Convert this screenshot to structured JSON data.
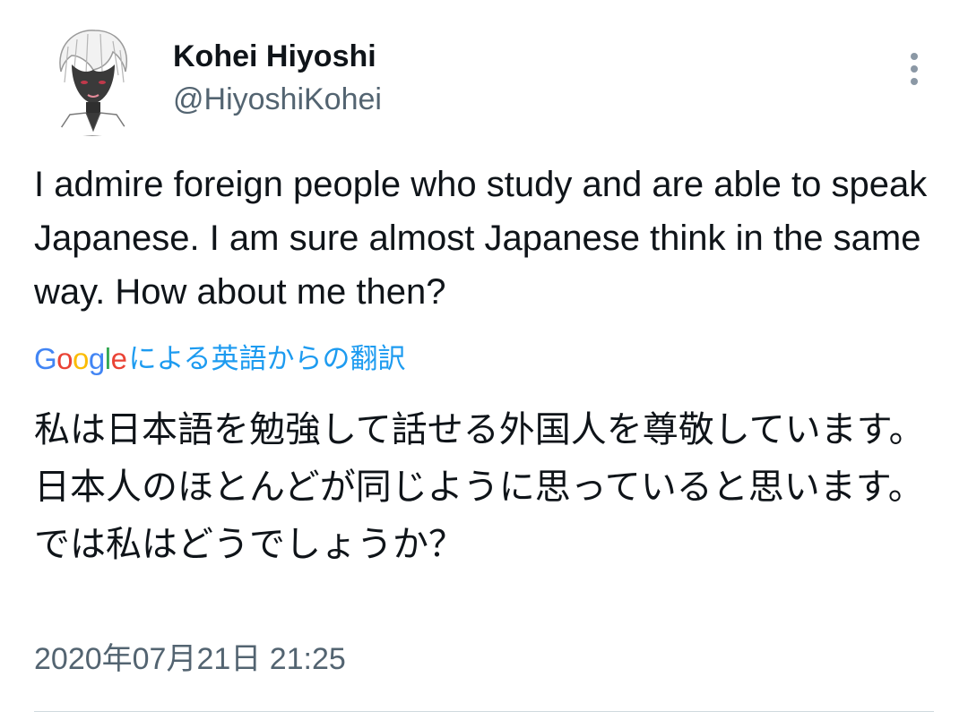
{
  "author": {
    "display_name": "Kohei Hiyoshi",
    "handle": "@HiyoshiKohei"
  },
  "tweet": {
    "text": "I admire foreign people who study and are able to speak Japanese. I am sure almost Japanese think in the same way. How about me then?",
    "translation_label": {
      "brand": "Google",
      "text": "による英語からの翻訳"
    },
    "translated_text": "私は日本語を勉強して話せる外国人を尊敬しています。日本人のほとんどが同じように思っていると思います。では私はどうでしょうか？",
    "timestamp": "2020年07月21日 21:25"
  },
  "icons": {
    "more": "more-vertical-icon",
    "avatar": "avatar-illustration"
  },
  "colors": {
    "text_primary": "#0f1419",
    "text_secondary": "#536471",
    "link": "#1d9bf0",
    "divider": "#cfd9de"
  }
}
